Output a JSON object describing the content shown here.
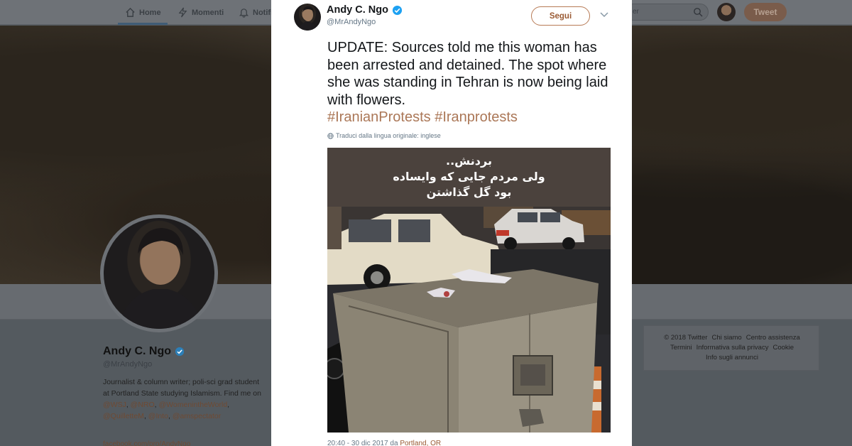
{
  "topbar": {
    "nav": [
      {
        "label": "Home",
        "icon": "home-icon"
      },
      {
        "label": "Momenti",
        "icon": "lightning-icon"
      },
      {
        "label": "Notifi",
        "icon": "bell-icon"
      }
    ],
    "search_placeholder": "er",
    "tweet_button": "Tweet"
  },
  "profile": {
    "name": "Andy C. Ngo",
    "handle": "@MrAndyNgo",
    "bio_text": "Journalist & column writer; poli-sci grad student at Portland State studying Islamism. Find me on ",
    "bio_links": [
      "@WSJ",
      "@NRO",
      "@WomenintheWorld",
      "@QuilletteM",
      "@Into",
      "@amspectator"
    ],
    "website": "facebook.com/pro/AndyNgo"
  },
  "footer": {
    "links": [
      "© 2018 Twitter",
      "Chi siamo",
      "Centro assistenza",
      "Termini",
      "Informativa sulla privacy",
      "Cookie",
      "Info sugli annunci"
    ]
  },
  "tweet": {
    "author_name": "Andy C. Ngo",
    "author_handle": "@MrAndyNgo",
    "follow_label": "Segui",
    "text": "UPDATE: Sources told me this woman has been arrested and detained. The spot where she was standing in Tehran is now being laid with flowers.",
    "hashtags": [
      "#IranianProtests",
      "#Iranprotests"
    ],
    "translate_label": "Traduci dalla lingua originale: inglese",
    "image_caption_lines": [
      "بردنش..",
      "ولی مردم جایی که وایساده",
      "بود گل گذاشتن"
    ],
    "time": "20:40",
    "date": "30 dic 2017 da",
    "location": "Portland, OR"
  },
  "colors": {
    "accent": "#ab7757",
    "follow_border": "#b77a55",
    "verified": "#1da1f2",
    "overlay": "#545a5f"
  }
}
